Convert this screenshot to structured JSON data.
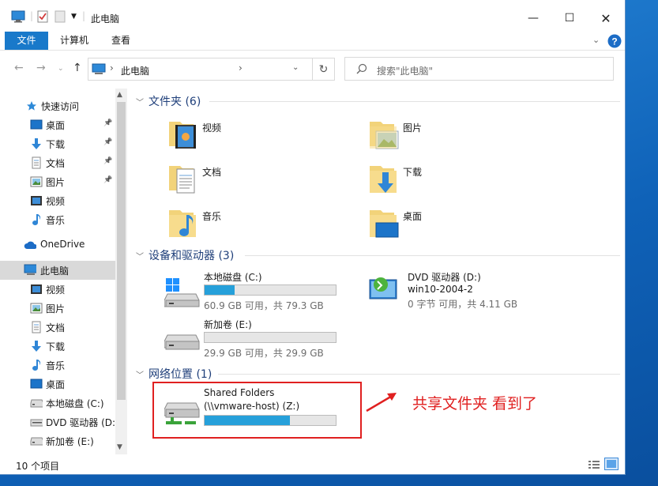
{
  "window": {
    "title": "此电脑"
  },
  "ribbon": {
    "tabs": [
      "文件",
      "计算机",
      "查看"
    ]
  },
  "address": {
    "location": "此电脑",
    "separator": "›"
  },
  "search": {
    "placeholder": "搜索\"此电脑\""
  },
  "sidebar": {
    "items": [
      {
        "label": "快速访问",
        "icon": "star-icon"
      },
      {
        "label": "桌面",
        "icon": "desktop-icon",
        "pinned": true
      },
      {
        "label": "下载",
        "icon": "download-icon",
        "pinned": true
      },
      {
        "label": "文档",
        "icon": "document-icon",
        "pinned": true
      },
      {
        "label": "图片",
        "icon": "picture-icon",
        "pinned": true
      },
      {
        "label": "视频",
        "icon": "video-icon"
      },
      {
        "label": "音乐",
        "icon": "music-icon"
      },
      {
        "label": "OneDrive",
        "icon": "cloud-icon"
      },
      {
        "label": "此电脑",
        "icon": "computer-icon",
        "selected": true
      },
      {
        "label": "视频",
        "icon": "video-icon"
      },
      {
        "label": "图片",
        "icon": "picture-icon"
      },
      {
        "label": "文档",
        "icon": "document-icon"
      },
      {
        "label": "下载",
        "icon": "download-icon"
      },
      {
        "label": "音乐",
        "icon": "music-icon"
      },
      {
        "label": "桌面",
        "icon": "desktop-icon"
      },
      {
        "label": "本地磁盘 (C:)",
        "icon": "drive-icon"
      },
      {
        "label": "DVD 驱动器 (D:",
        "icon": "dvd-icon"
      },
      {
        "label": "新加卷 (E:)",
        "icon": "drive-icon"
      }
    ]
  },
  "groups": {
    "folders": "文件夹 (6)",
    "devices": "设备和驱动器 (3)",
    "network": "网络位置 (1)"
  },
  "folders": [
    {
      "name": "视频",
      "icon": "video-folder-icon"
    },
    {
      "name": "图片",
      "icon": "picture-folder-icon"
    },
    {
      "name": "文档",
      "icon": "document-folder-icon"
    },
    {
      "name": "下载",
      "icon": "download-folder-icon"
    },
    {
      "name": "音乐",
      "icon": "music-folder-icon"
    },
    {
      "name": "桌面",
      "icon": "desktop-folder-icon"
    }
  ],
  "drives": [
    {
      "name": "本地磁盘 (C:)",
      "detail": "60.9 GB 可用，共 79.3 GB",
      "used_fraction": 0.23
    },
    {
      "name": "DVD 驱动器 (D:)",
      "line2": "win10-2004-2",
      "detail": "0 字节 可用，共 4.11 GB"
    },
    {
      "name": "新加卷 (E:)",
      "detail": "29.9 GB 可用，共 29.9 GB",
      "used_fraction": 0.0
    }
  ],
  "network": [
    {
      "name": "Shared Folders",
      "line2": "(\\\\vmware-host) (Z:)",
      "used_fraction": 0.65
    }
  ],
  "annotation": "共享文件夹 看到了",
  "status": {
    "count": "10 个项目"
  },
  "colors": {
    "accent": "#1979ca",
    "annotation": "#e02020",
    "bar": "#26a0da"
  }
}
